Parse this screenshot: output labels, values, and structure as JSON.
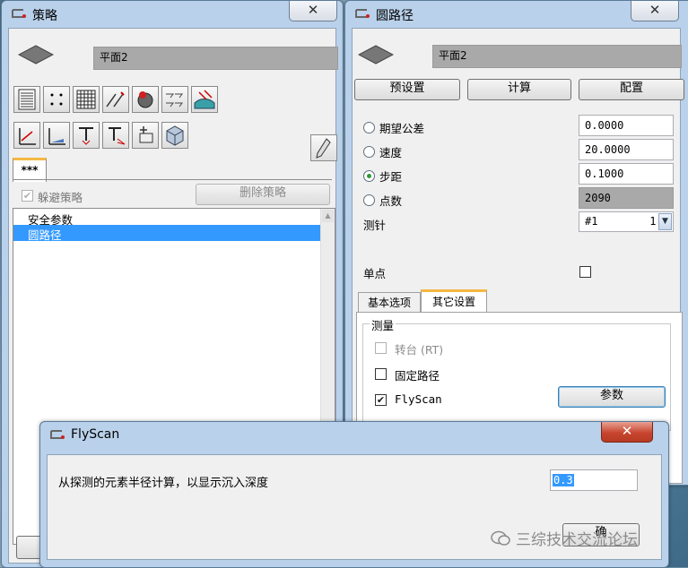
{
  "strategy_window": {
    "title": "策略",
    "close_glyph": "✕",
    "plane_name": "平面2",
    "tab_label": "***",
    "avoid_label": "躲避策略",
    "avoid_checked": true,
    "delete_button": "删除策略",
    "list_items": [
      "安全参数",
      "圆路径"
    ],
    "selected_index": 1
  },
  "path_window": {
    "title": "圆路径",
    "close_glyph": "✕",
    "plane_name": "平面2",
    "buttons": {
      "preset": "预设置",
      "compute": "计算",
      "config": "配置"
    },
    "params": [
      {
        "label": "期望公差",
        "value": "0.0000",
        "selected": false,
        "readonly": false
      },
      {
        "label": "速度",
        "value": "20.0000",
        "selected": false,
        "readonly": false
      },
      {
        "label": "步距",
        "value": "0.1000",
        "selected": true,
        "readonly": false
      },
      {
        "label": "点数",
        "value": "2090",
        "selected": false,
        "readonly": true
      }
    ],
    "probe_label": "测针",
    "probe_value": "#1        1",
    "single_point_label": "单点",
    "tabs": [
      "基本选项",
      "其它设置"
    ],
    "active_tab": 1,
    "group_title": "测量",
    "rotary_label": "转台 (RT)",
    "fixed_path_label": "固定路径",
    "flyscan_label": "FlyScan",
    "flyscan_checked": true,
    "params_button": "参数"
  },
  "flyscan_dialog": {
    "title": "FlyScan",
    "close_glyph": "✕",
    "message": "从探测的元素半径计算，以显示沉入深度",
    "depth_value": "0.3",
    "ok_button": "确",
    "watermark": "三综技术交流论坛"
  },
  "colors": {
    "title_bar": "#b9d1ea",
    "selection": "#3399ff",
    "close_red": "#c7452f",
    "radio_dot": "#2c9a38"
  }
}
